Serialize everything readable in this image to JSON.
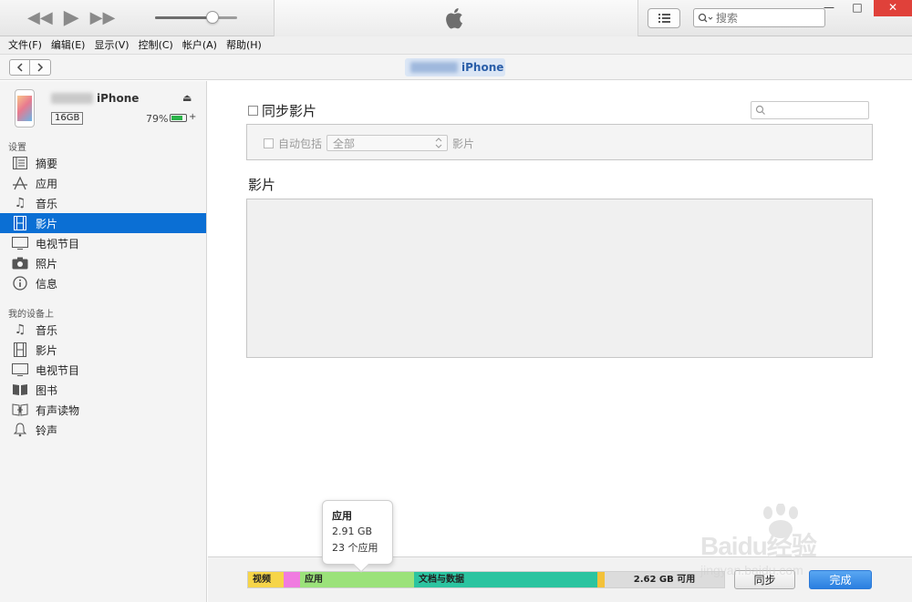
{
  "toolbar": {
    "search_placeholder": "搜索",
    "volume_level": 0.7,
    "window_controls": {
      "minimize": "—",
      "maximize": "□",
      "close": "✕"
    }
  },
  "menu": [
    "文件(F)",
    "编辑(E)",
    "显示(V)",
    "控制(C)",
    "帐户(A)",
    "帮助(H)"
  ],
  "nav": {
    "device_label": "iPhone"
  },
  "device": {
    "name_suffix": "iPhone",
    "capacity": "16GB",
    "battery_percent": "79%",
    "battery_level": 0.79
  },
  "sidebar": {
    "settings_title": "设置",
    "settings_items": [
      {
        "label": "摘要",
        "icon": "summary-icon"
      },
      {
        "label": "应用",
        "icon": "apps-icon"
      },
      {
        "label": "音乐",
        "icon": "music-icon"
      },
      {
        "label": "影片",
        "icon": "movies-icon",
        "active": true
      },
      {
        "label": "电视节目",
        "icon": "tv-icon"
      },
      {
        "label": "照片",
        "icon": "camera-icon"
      },
      {
        "label": "信息",
        "icon": "info-icon"
      }
    ],
    "ondevice_title": "我的设备上",
    "ondevice_items": [
      {
        "label": "音乐",
        "icon": "music-icon"
      },
      {
        "label": "影片",
        "icon": "movies-icon"
      },
      {
        "label": "电视节目",
        "icon": "tv-icon"
      },
      {
        "label": "图书",
        "icon": "book-icon"
      },
      {
        "label": "有声读物",
        "icon": "audiobook-icon"
      },
      {
        "label": "铃声",
        "icon": "bell-icon"
      }
    ]
  },
  "main": {
    "sync_label": "同步影片",
    "auto_include_label": "自动包括",
    "auto_include_value": "全部",
    "auto_include_suffix": "影片",
    "movies_title": "影片"
  },
  "storage": {
    "segments": [
      {
        "label": "视频",
        "color": "#f6d548",
        "fraction": 0.075
      },
      {
        "label": "",
        "color": "#f07be0",
        "fraction": 0.035
      },
      {
        "label": "应用",
        "color": "#9be27a",
        "fraction": 0.24
      },
      {
        "label": "文档与数据",
        "color": "#2bc4a0",
        "fraction": 0.385
      },
      {
        "label": "",
        "color": "#f3c23a",
        "fraction": 0.015
      },
      {
        "label": "2.62 GB 可用",
        "color": "#dcdcdc",
        "fraction": 0.25
      }
    ],
    "sync_button": "同步",
    "done_button": "完成"
  },
  "tooltip": {
    "title": "应用",
    "size": "2.91 GB",
    "count": "23 个应用"
  },
  "watermark": {
    "brand": "Baidu经验",
    "url": "jingyan.baidu.com"
  }
}
